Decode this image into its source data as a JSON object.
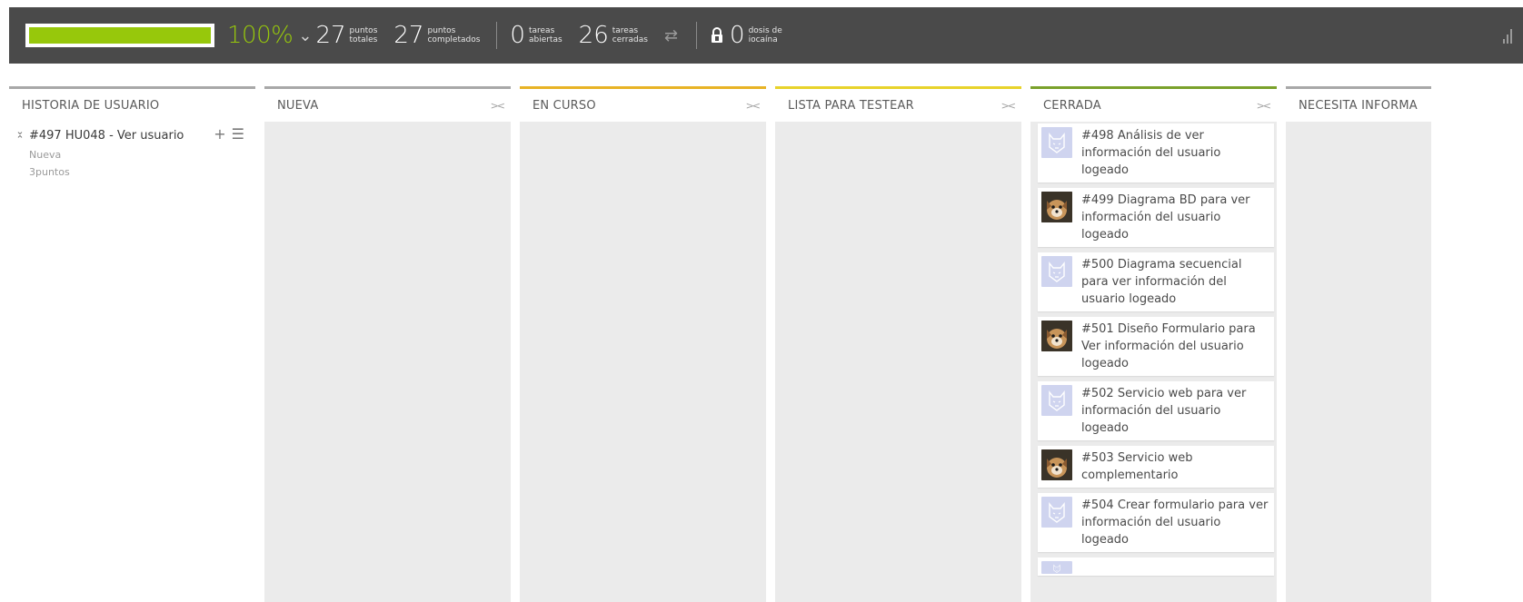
{
  "stats": {
    "progress_value": 1.0,
    "progress_label": "100%",
    "progress_color": "#97c80b",
    "total_points": "27",
    "total_points_label_top": "puntos",
    "total_points_label_bottom": "totales",
    "completed_points": "27",
    "completed_points_label_top": "puntos",
    "completed_points_label_bottom": "completados",
    "open_tasks": "0",
    "open_tasks_label_top": "tareas",
    "open_tasks_label_bottom": "abiertas",
    "closed_tasks": "26",
    "closed_tasks_label_top": "tareas",
    "closed_tasks_label_bottom": "cerradas",
    "iocaine": "0",
    "iocaine_label_top": "dosis de",
    "iocaine_label_bottom": "iocaína"
  },
  "columns": {
    "user_story": "HISTORIA DE USUARIO",
    "nueva": "NUEVA",
    "en_curso": "EN CURSO",
    "lista_testear": "LISTA PARA TESTEAR",
    "cerrada": "CERRADA",
    "necesita_info": "NECESITA INFORMA",
    "collapse_glyph": "><"
  },
  "user_story": {
    "title": "#497 HU048 - Ver usuario",
    "status": "Nueva",
    "points": "3puntos"
  },
  "tasks": [
    {
      "text": "#498 Análisis de ver información del usuario logeado",
      "avatar": "wolf"
    },
    {
      "text": "#499 Diagrama BD para ver información del usuario logeado",
      "avatar": "dog"
    },
    {
      "text": "#500 Diagrama secuencial para ver información del usuario logeado",
      "avatar": "wolf"
    },
    {
      "text": "#501 Diseño Formulario para Ver información del usuario logeado",
      "avatar": "dog"
    },
    {
      "text": "#502 Servicio web para ver información del usuario logeado",
      "avatar": "wolf"
    },
    {
      "text": "#503 Servicio web complementario",
      "avatar": "dog"
    },
    {
      "text": "#504 Crear formulario para ver información del usuario logeado",
      "avatar": "wolf"
    }
  ],
  "colors": {
    "header_bg": "#4a4a4a",
    "nueva": "#a8a8a8",
    "en_curso": "#e8b325",
    "lista_testear": "#e8d32b",
    "cerrada": "#7aa12b"
  }
}
